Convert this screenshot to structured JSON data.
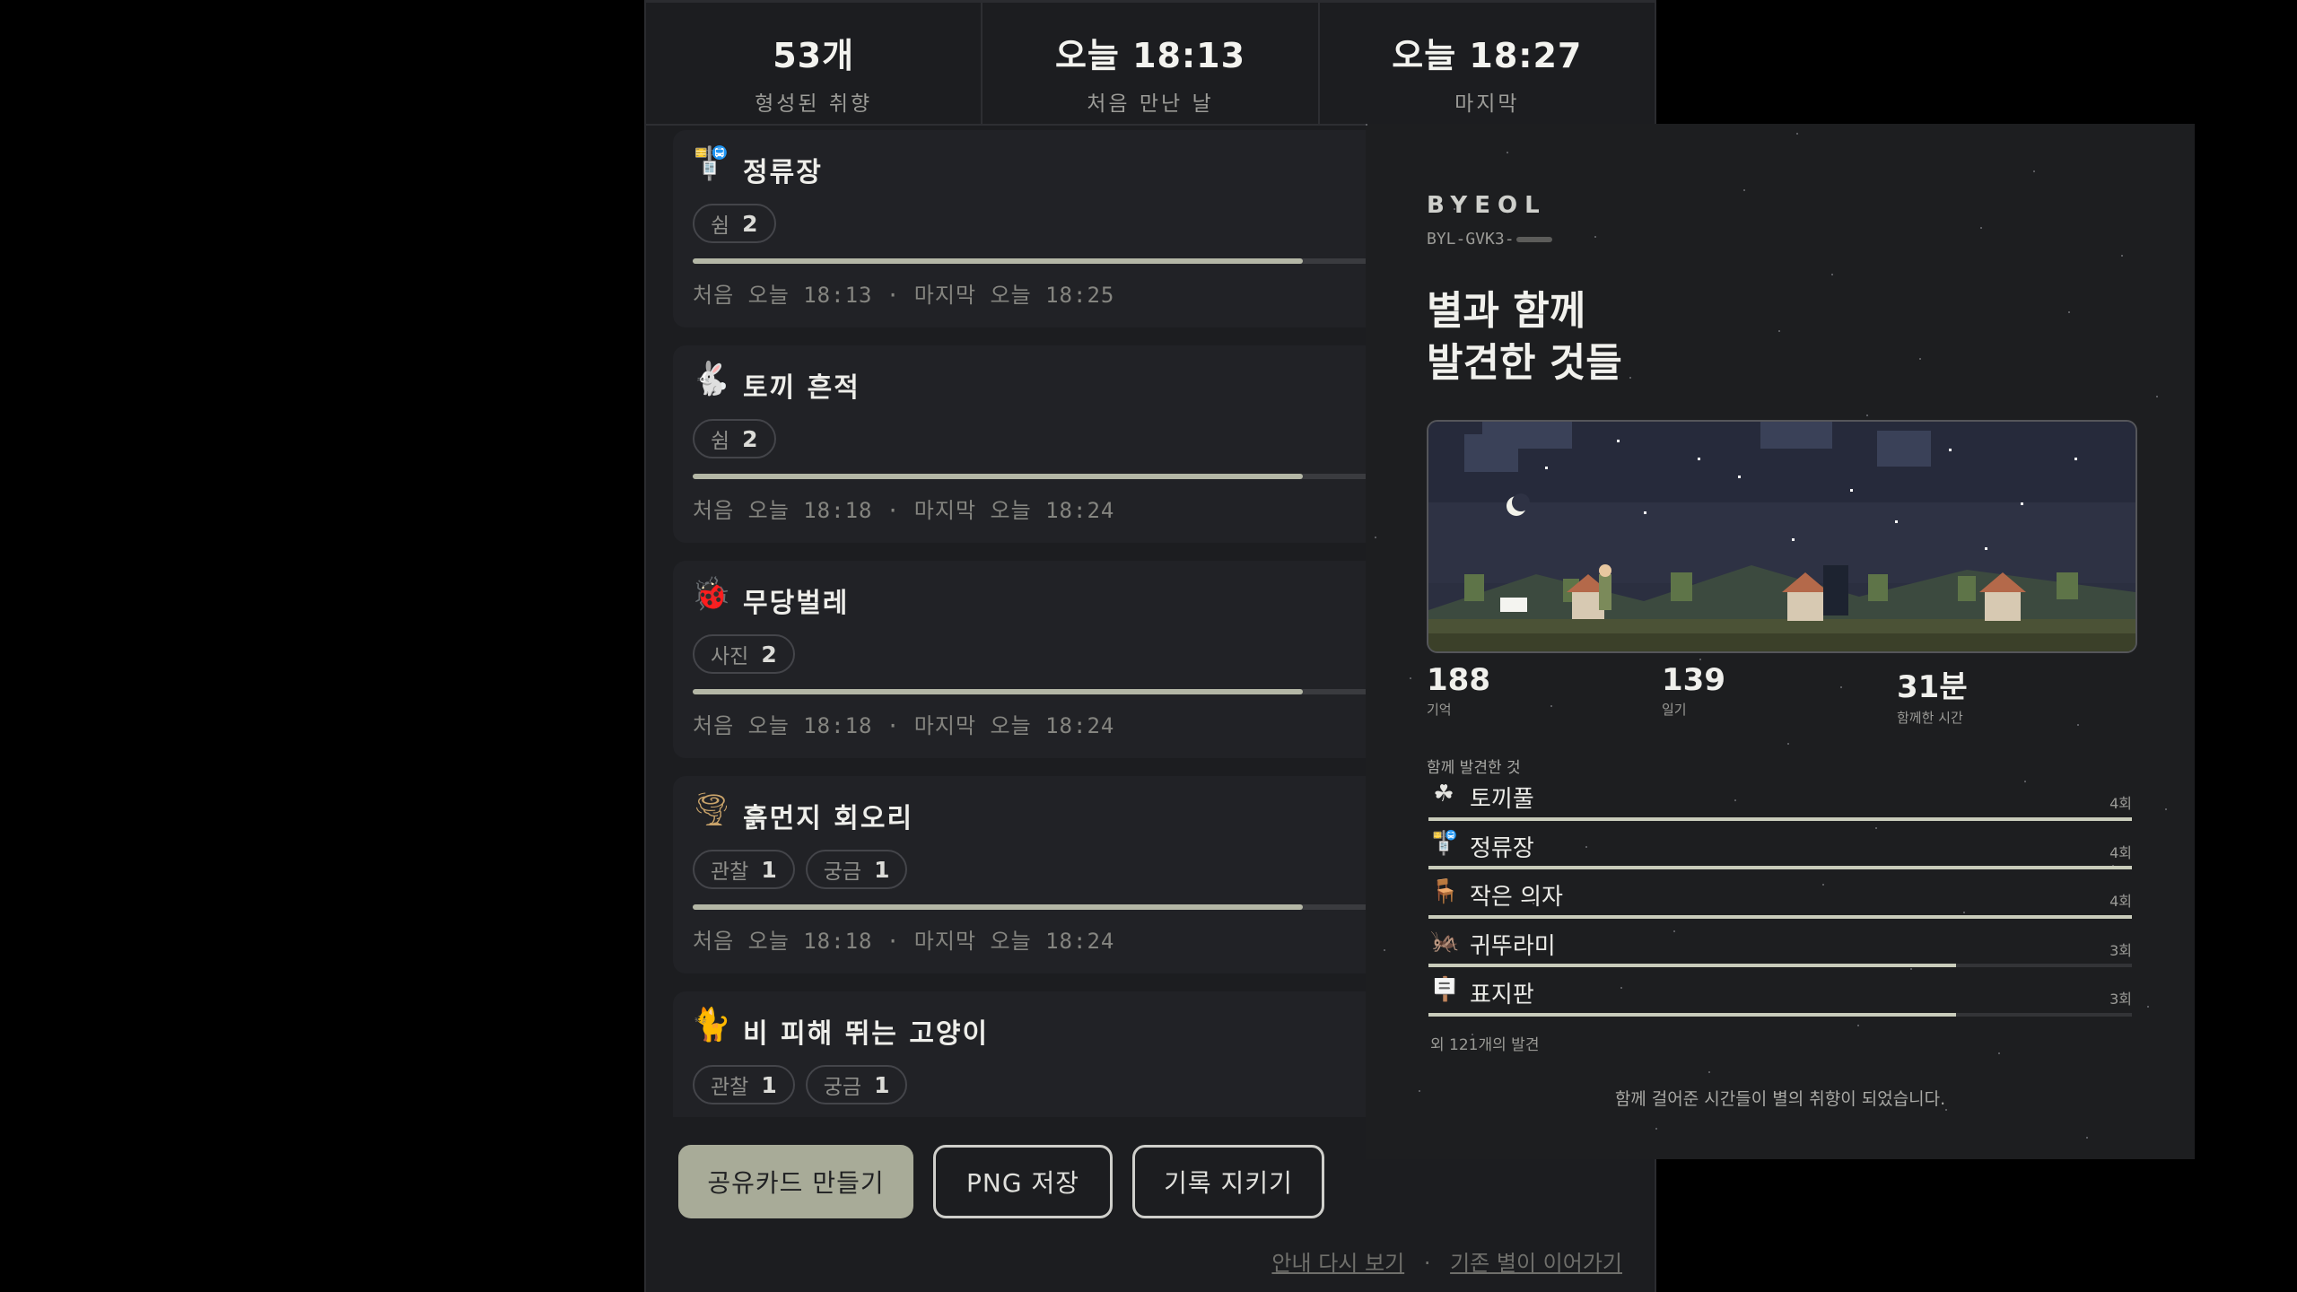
{
  "stats": [
    {
      "value": "53개",
      "label": "형성된 취향"
    },
    {
      "value": "오늘 18:13",
      "label": "처음 만난 날"
    },
    {
      "value": "오늘 18:27",
      "label": "마지막"
    }
  ],
  "items": [
    {
      "icon": "bus-stop-icon",
      "glyph": "🚏",
      "title": "정류장",
      "chips": [
        {
          "label": "쉼",
          "count": "2"
        }
      ],
      "progress": 0.63,
      "meta": "처음 오늘 18:13 · 마지막 오늘 18:25"
    },
    {
      "icon": "rabbit-icon",
      "glyph": "🐇",
      "title": "토끼 흔적",
      "chips": [
        {
          "label": "쉼",
          "count": "2"
        }
      ],
      "progress": 0.63,
      "meta": "처음 오늘 18:18 · 마지막 오늘 18:24"
    },
    {
      "icon": "ladybug-icon",
      "glyph": "🐞",
      "title": "무당벌레",
      "chips": [
        {
          "label": "사진",
          "count": "2"
        }
      ],
      "progress": 0.63,
      "meta": "처음 오늘 18:18 · 마지막 오늘 18:24"
    },
    {
      "icon": "tornado-icon",
      "glyph": "🌪",
      "title": "흙먼지 회오리",
      "chips": [
        {
          "label": "관찰",
          "count": "1"
        },
        {
          "label": "궁금",
          "count": "1"
        }
      ],
      "progress": 0.63,
      "meta": "처음 오늘 18:18 · 마지막 오늘 18:24"
    },
    {
      "icon": "cat-icon",
      "glyph": "🐈",
      "title": "비 피해 뛰는 고양이",
      "chips": [
        {
          "label": "관찰",
          "count": "1"
        },
        {
          "label": "궁금",
          "count": "1"
        }
      ],
      "progress": 0.63,
      "meta": ""
    }
  ],
  "buttons": {
    "share": "공유카드 만들기",
    "png": "PNG 저장",
    "keep": "기록 지키기"
  },
  "links": {
    "guide": "안내 다시 보기",
    "sep": "·",
    "continue": "기존 별이 이어가기"
  },
  "card": {
    "brand": "BYEOL",
    "code": "BYL-GVK3-",
    "headline1": "별과 함께",
    "headline2": "발견한 것들",
    "stats": [
      {
        "value": "188",
        "label": "기억"
      },
      {
        "value": "139",
        "label": "일기"
      },
      {
        "value": "31분",
        "label": "함께한 시간"
      }
    ],
    "found_title": "함께 발견한 것",
    "found": [
      {
        "icon": "clover-icon",
        "glyph": "☘",
        "label": "토끼풀",
        "count": "4회",
        "level": 1.0
      },
      {
        "icon": "bus-stop-icon",
        "glyph": "🚏",
        "label": "정류장",
        "count": "4회",
        "level": 1.0
      },
      {
        "icon": "chair-icon",
        "glyph": "🪑",
        "label": "작은 의자",
        "count": "4회",
        "level": 1.0
      },
      {
        "icon": "cricket-icon",
        "glyph": "🦗",
        "label": "귀뚜라미",
        "count": "3회",
        "level": 0.75
      },
      {
        "icon": "signboard-icon",
        "glyph": "🪧",
        "label": "표지판",
        "count": "3회",
        "level": 0.75
      }
    ],
    "more": "외 121개의 발견",
    "footer": "함께 걸어준 시간들이 별의 취향이 되었습니다."
  }
}
